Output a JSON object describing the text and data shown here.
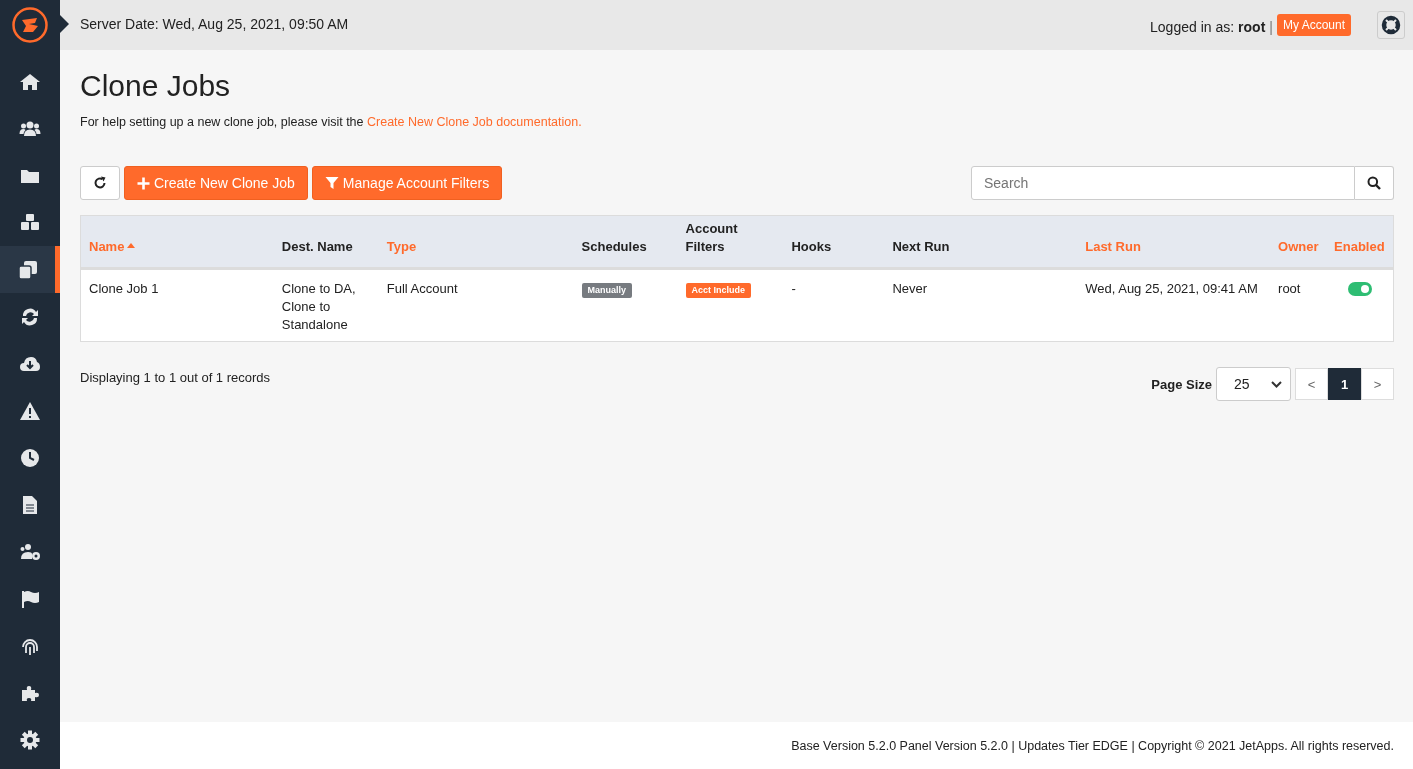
{
  "sidebar": {
    "items": [
      {
        "kind": "home",
        "selected": false
      },
      {
        "kind": "users",
        "selected": false
      },
      {
        "kind": "folder",
        "selected": false
      },
      {
        "kind": "cubes",
        "selected": false
      },
      {
        "kind": "clone",
        "selected": true
      },
      {
        "kind": "sync",
        "selected": false
      },
      {
        "kind": "download",
        "selected": false
      },
      {
        "kind": "warning",
        "selected": false
      },
      {
        "kind": "clock",
        "selected": false
      },
      {
        "kind": "file",
        "selected": false
      },
      {
        "kind": "usergear",
        "selected": false
      },
      {
        "kind": "flag",
        "selected": false
      },
      {
        "kind": "fingerprint",
        "selected": false
      },
      {
        "kind": "puzzle",
        "selected": false
      },
      {
        "kind": "gear",
        "selected": false
      }
    ]
  },
  "topbar": {
    "server_date": "Server Date: Wed, Aug 25, 2021, 09:50 AM",
    "logged_in_label": "Logged in as:",
    "user": "root",
    "separator": "|",
    "account_button": "My Account"
  },
  "page": {
    "title": "Clone Jobs",
    "help_text": "For help setting up a new clone job, please visit the",
    "help_link": "Create New Clone Job documentation."
  },
  "toolbar": {
    "create_button": "Create New Clone Job",
    "filters_button": "Manage Account Filters",
    "search": {
      "placeholder": "Search"
    }
  },
  "table": {
    "columns": [
      {
        "label": "Name",
        "sortable": true,
        "sorted": true
      },
      {
        "label": "Dest. Name",
        "sortable": false,
        "sorted": false
      },
      {
        "label": "Type",
        "sortable": true,
        "sorted": false
      },
      {
        "label": "Schedules",
        "sortable": false,
        "sorted": false
      },
      {
        "label": "Account Filters",
        "sortable": false,
        "sorted": false
      },
      {
        "label": "Hooks",
        "sortable": false,
        "sorted": false
      },
      {
        "label": "Next Run",
        "sortable": false,
        "sorted": false
      },
      {
        "label": "Last Run",
        "sortable": true,
        "sorted": false
      },
      {
        "label": "Owner",
        "sortable": true,
        "sorted": false
      },
      {
        "label": "Enabled",
        "sortable": true,
        "sorted": false
      }
    ],
    "rows": [
      {
        "name": "Clone Job 1",
        "dest_name": "Clone to DA, Clone to Standalone",
        "type": "Full Account",
        "schedules": {
          "label": "Manually",
          "color": "#777b80"
        },
        "account_filters": {
          "label": "Acct Include",
          "color": "#ff6a2b"
        },
        "hooks": "-",
        "next_run": "Never",
        "last_run": "Wed, Aug 25, 2021, 09:41 AM",
        "owner": "root",
        "enabled": true
      }
    ]
  },
  "summary": "Displaying 1 to 1 out of 1 records",
  "pagination": {
    "page_size_label": "Page Size",
    "page_size": "25",
    "prev": "<",
    "pages": [
      {
        "label": "1",
        "selected": true
      }
    ],
    "next": ">"
  },
  "footer": "Base Version 5.2.0 Panel Version 5.2.0 | Updates Tier EDGE | Copyright © 2021 JetApps. All rights reserved."
}
